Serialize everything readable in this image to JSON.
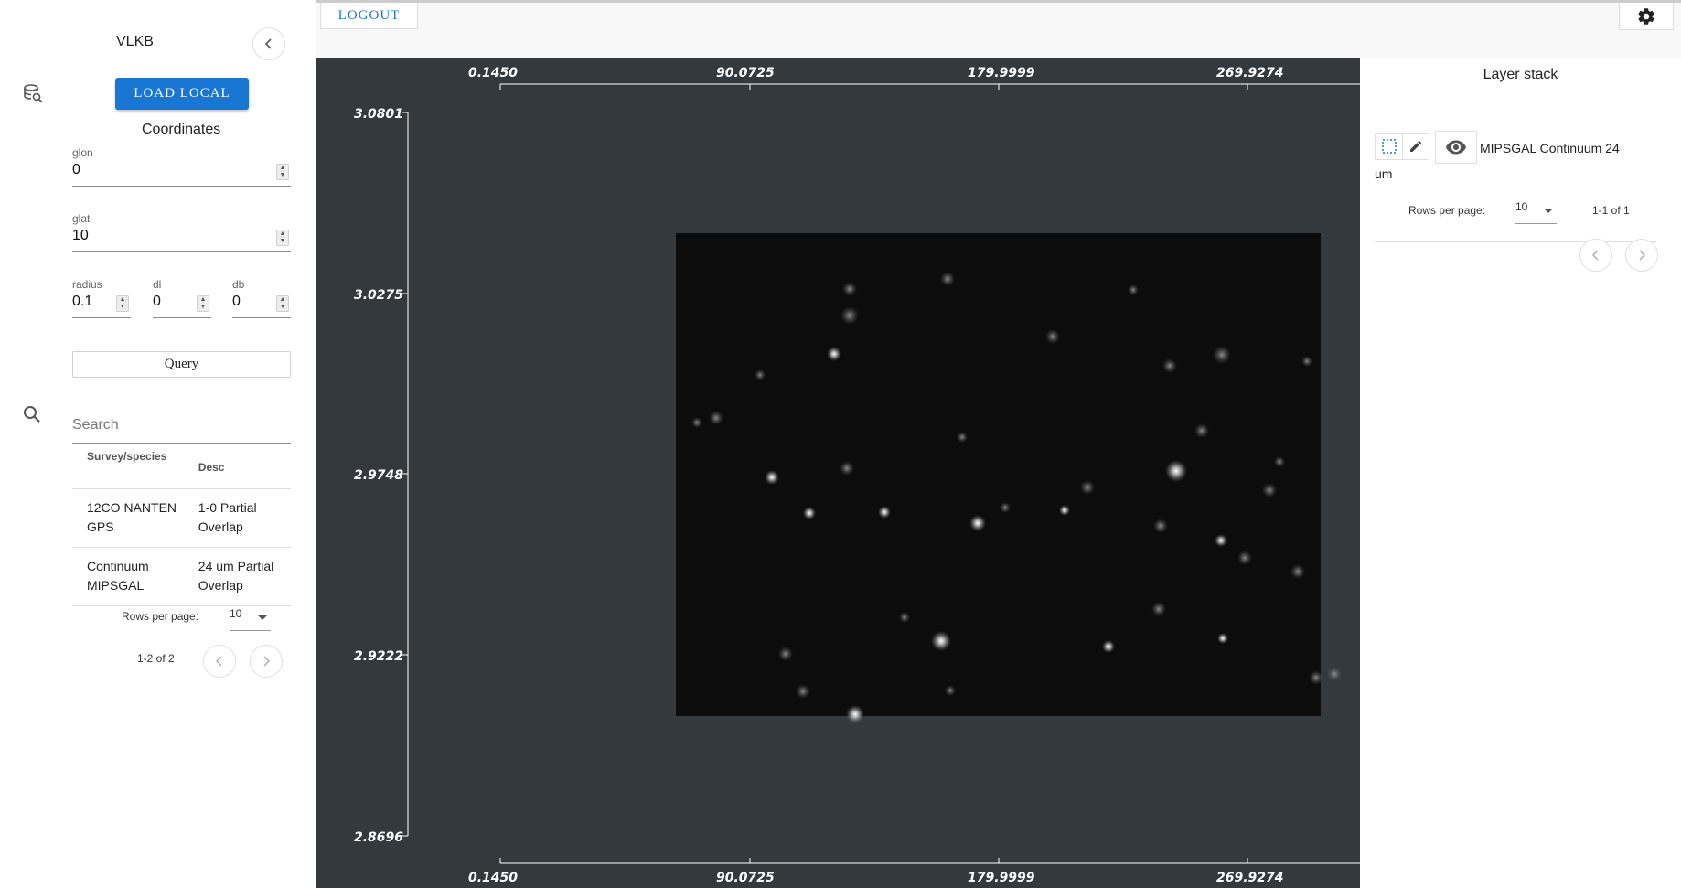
{
  "left_panel": {
    "app_title": "VLKB",
    "load_button": "LOAD LOCAL",
    "coordinates_title": "Coordinates",
    "fields": {
      "glon": {
        "label": "glon",
        "value": "0"
      },
      "glat": {
        "label": "glat",
        "value": "10"
      },
      "radius": {
        "label": "radius",
        "value": "0.1"
      },
      "dl": {
        "label": "dl",
        "value": "0"
      },
      "db": {
        "label": "db",
        "value": "0"
      }
    },
    "query_button": "Query",
    "search": {
      "placeholder": "Search"
    },
    "table": {
      "headers": [
        "Survey/species",
        "Desc"
      ],
      "rows": [
        {
          "survey": "12CO NANTEN GPS",
          "desc": "1-0 Partial Overlap"
        },
        {
          "survey": "Continuum MIPSGAL",
          "desc": "24 um Partial Overlap"
        }
      ]
    },
    "pager": {
      "rows_label": "Rows per page:",
      "rows_value": "10",
      "range": "1-2 of 2"
    }
  },
  "top_bar": {
    "logout": "LOGOUT"
  },
  "viewer": {
    "x_ticks": [
      "0.1450",
      "90.0725",
      "179.9999",
      "269.9274"
    ],
    "y_ticks": [
      "3.0801",
      "3.0275",
      "2.9748",
      "2.9222",
      "2.8696"
    ],
    "background_color": "#34393d",
    "image_color": "#0c0c0c"
  },
  "right_panel": {
    "title": "Layer stack",
    "layer_name": "MIPSGAL Continuum 24 um",
    "pager": {
      "rows_label": "Rows per page:",
      "rows_value": "10",
      "range": "1-1 of 1"
    }
  },
  "colors": {
    "accent": "#1976d2"
  },
  "icons": [
    "database-search-icon",
    "chevron-left-icon",
    "search-icon",
    "settings-gear-icon",
    "selection-icon",
    "pencil-icon",
    "eye-icon",
    "chevron-right-icon",
    "dropdown-caret-icon"
  ]
}
